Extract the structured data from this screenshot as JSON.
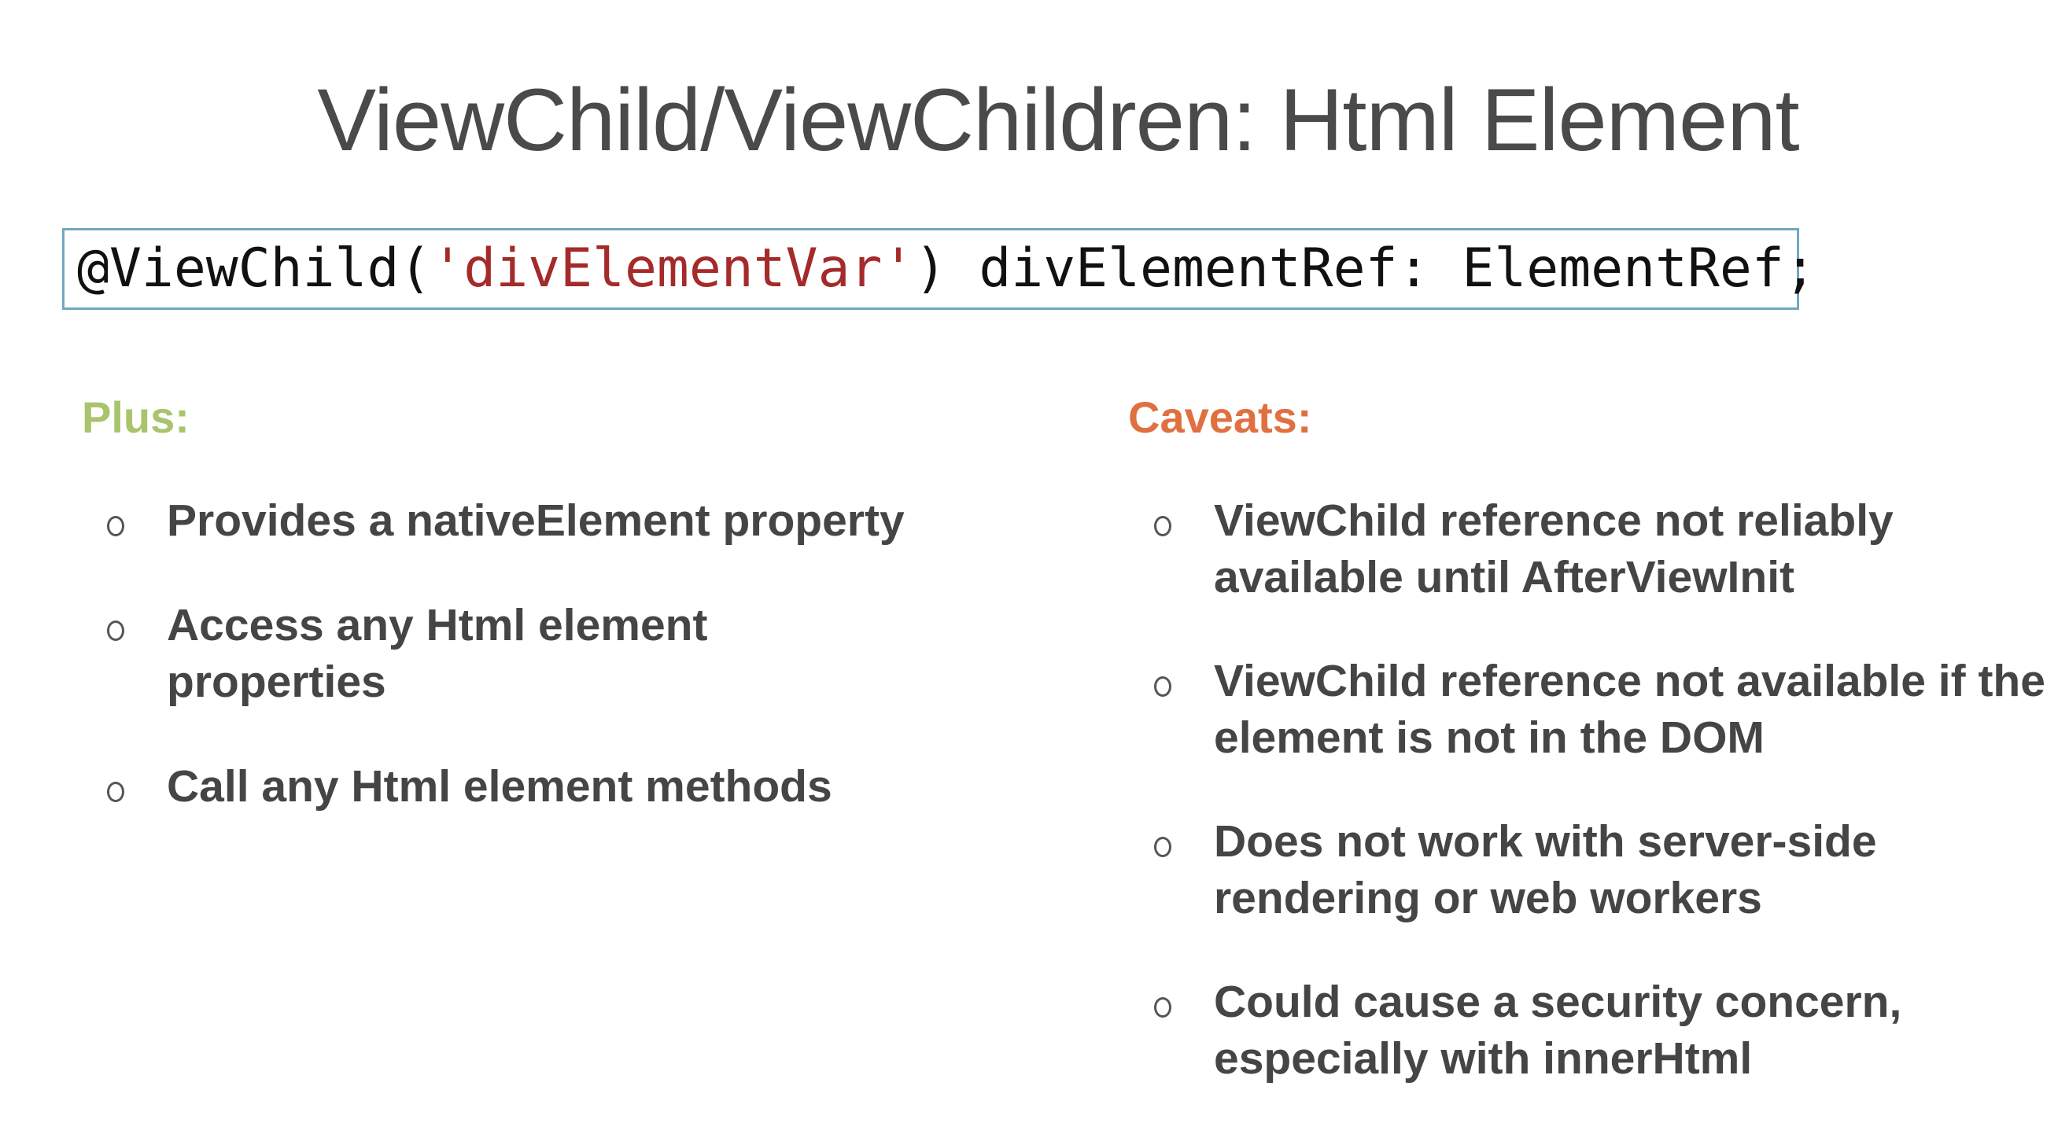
{
  "title": "ViewChild/ViewChildren: Html Element",
  "code": {
    "prefix": "@ViewChild(",
    "string": "'divElementVar'",
    "suffix": ") divElementRef: ElementRef;"
  },
  "plus": {
    "heading": "Plus:",
    "items": [
      "Provides a nativeElement property",
      "Access any Html element properties",
      "Call any Html element methods"
    ]
  },
  "caveats": {
    "heading": "Caveats:",
    "items": [
      "ViewChild reference not reliably available until AfterViewInit",
      "ViewChild reference not available if the element is not in the DOM",
      "Does not work with server-side rendering or web workers",
      "Could cause a security concern, especially with innerHtml"
    ]
  },
  "colors": {
    "plus": "#a9c46c",
    "caveats": "#e07040",
    "string": "#a52a2a",
    "border": "#6fa8c0"
  }
}
